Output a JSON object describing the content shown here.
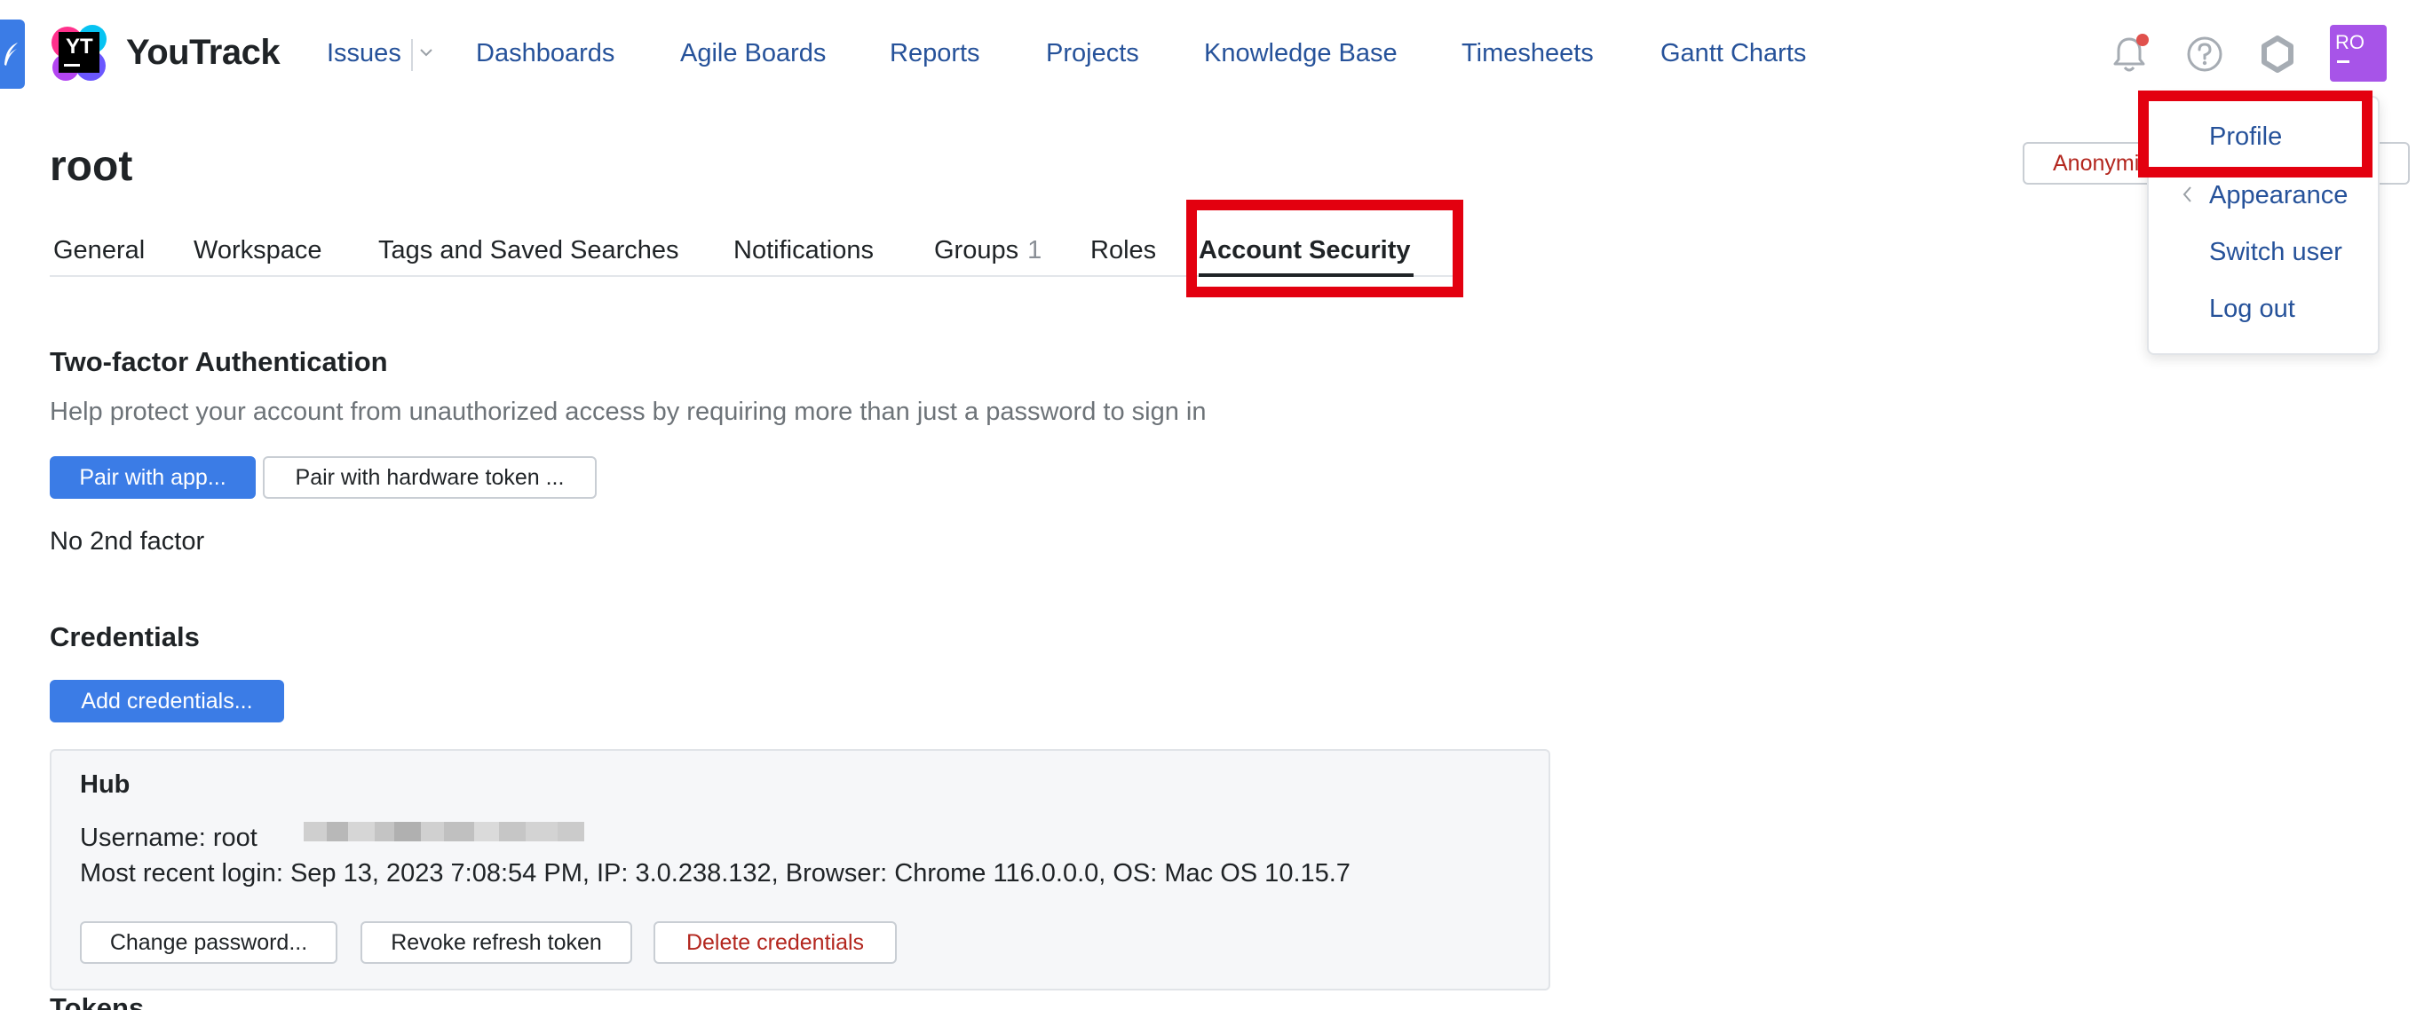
{
  "header": {
    "logo_text": "YouTrack",
    "logo_mark": "YT",
    "nav": [
      {
        "label": "Issues",
        "name": "nav-issues"
      },
      {
        "label": "Dashboards",
        "name": "nav-dashboards"
      },
      {
        "label": "Agile Boards",
        "name": "nav-agile-boards"
      },
      {
        "label": "Reports",
        "name": "nav-reports"
      },
      {
        "label": "Projects",
        "name": "nav-projects"
      },
      {
        "label": "Knowledge Base",
        "name": "nav-knowledge-base"
      },
      {
        "label": "Timesheets",
        "name": "nav-timesheets"
      },
      {
        "label": "Gantt Charts",
        "name": "nav-gantt-charts"
      }
    ],
    "avatar_initials": "RO",
    "icons": [
      "bell-icon",
      "help-icon",
      "settings-icon",
      "feather-icon",
      "chevron-down-icon"
    ]
  },
  "page": {
    "title": "root",
    "anonymize_button": "Anonymize"
  },
  "tabs": [
    {
      "label": "General",
      "count": ""
    },
    {
      "label": "Workspace",
      "count": ""
    },
    {
      "label": "Tags and Saved Searches",
      "count": ""
    },
    {
      "label": "Notifications",
      "count": ""
    },
    {
      "label": "Groups",
      "count": "1"
    },
    {
      "label": "Roles",
      "count": ""
    },
    {
      "label": "Account Security",
      "count": "",
      "active": true
    }
  ],
  "user_menu": {
    "items": [
      "Profile",
      "Appearance",
      "Switch user",
      "Log out"
    ]
  },
  "two_factor": {
    "heading": "Two-factor Authentication",
    "description": "Help protect your account from unauthorized access by requiring more than just a password to sign in",
    "pair_app_button": "Pair with app...",
    "pair_hardware_button": "Pair with hardware token ...",
    "status": "No 2nd factor"
  },
  "credentials": {
    "heading": "Credentials",
    "add_button": "Add credentials...",
    "card": {
      "title": "Hub",
      "username": "Username: root",
      "last_login": "Most recent login: Sep 13, 2023 7:08:54 PM, IP: 3.0.238.132, Browser: Chrome 116.0.0.0, OS: Mac OS 10.15.7",
      "change_password_button": "Change password...",
      "revoke_button": "Revoke refresh token",
      "delete_button": "Delete credentials"
    }
  },
  "tokens": {
    "heading": "Tokens"
  },
  "colors": {
    "accent": "#3b7ce6",
    "link": "#26529a",
    "highlight": "#e3000f",
    "avatar": "#a754e8",
    "danger": "#b3261e"
  }
}
